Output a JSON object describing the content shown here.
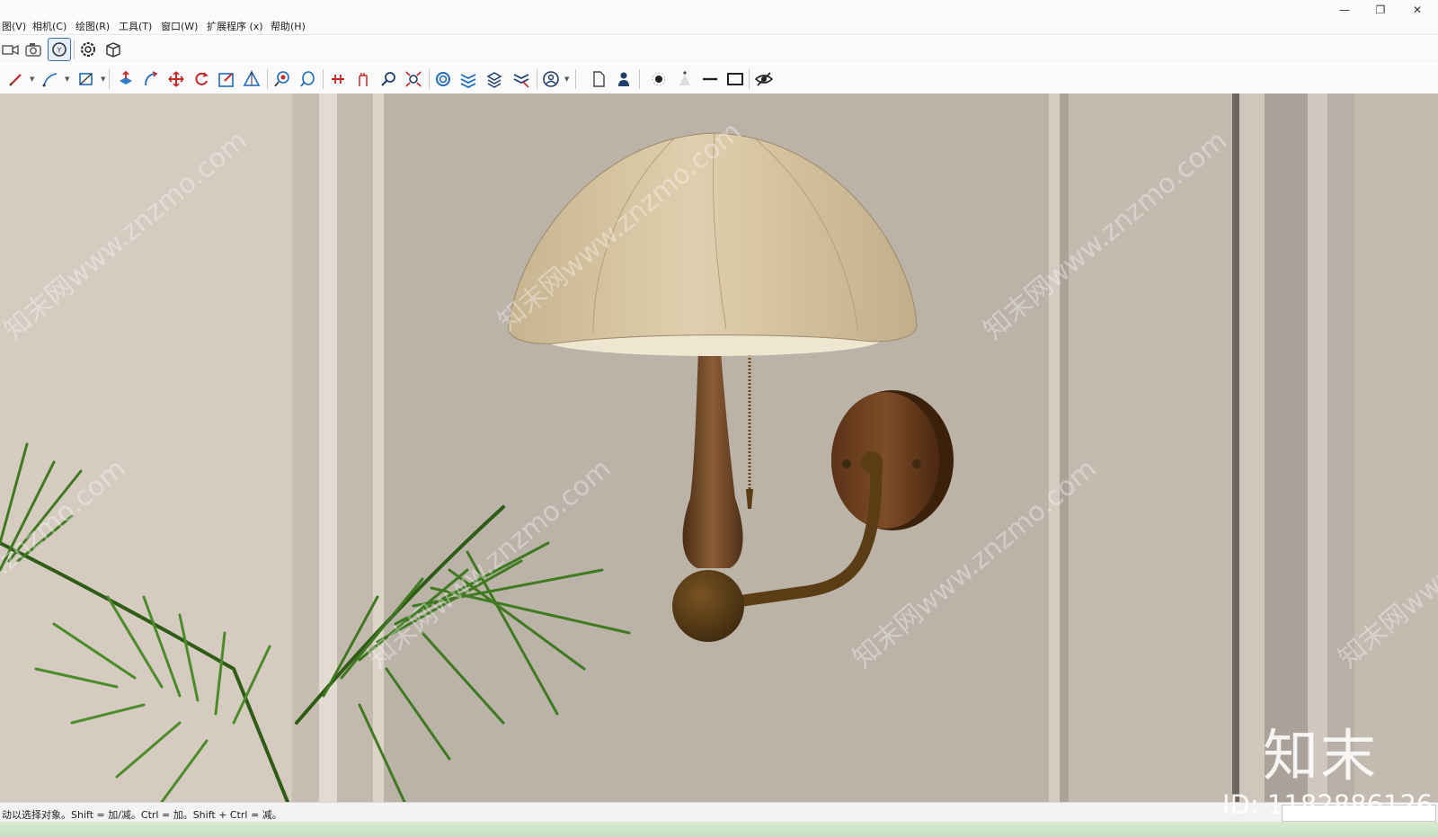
{
  "menu": {
    "items": [
      "图(V)",
      "相机(C)",
      "绘图(R)",
      "工具(T)",
      "窗口(W)",
      "扩展程序 (x)",
      "帮助(H)"
    ]
  },
  "window_controls": [
    "minimize-icon",
    "restore-icon",
    "close-icon"
  ],
  "toolbar1": {
    "icons": [
      "video-camera-icon",
      "camera-icon",
      "sync-orbit-icon",
      "gear-flower-icon",
      "box-export-icon"
    ]
  },
  "toolbar2": {
    "icons": [
      "pencil-icon",
      "line-icon",
      "shape-icon",
      "push-pull-icon",
      "follow-me-icon",
      "move-icon",
      "rotate-icon",
      "scale-icon",
      "section-icon",
      "paint-icon",
      "eraser-icon",
      "walk-icon",
      "hand-icon",
      "zoom-icon",
      "zoom-extents-icon",
      "component-icon",
      "layers-icon",
      "stack-icon",
      "styles-icon",
      "user-circle-icon",
      "page-icon",
      "person-icon",
      "dot-icon",
      "cone-icon",
      "dash-icon",
      "rectangle-icon",
      "hidden-eye-icon"
    ]
  },
  "status": {
    "text": "动以选择对象。Shift = 加/减。Ctrl = 加。Shift + Ctrl = 减。"
  },
  "watermark": {
    "logo": "知末",
    "id": "ID: 1182886126",
    "diagonal": "知末网www.znzmo.com"
  },
  "colors": {
    "wall": "#bbb2a8",
    "shade": "#d9c6a4",
    "wood": "#6b4527",
    "leaf": "#3f7a21"
  }
}
